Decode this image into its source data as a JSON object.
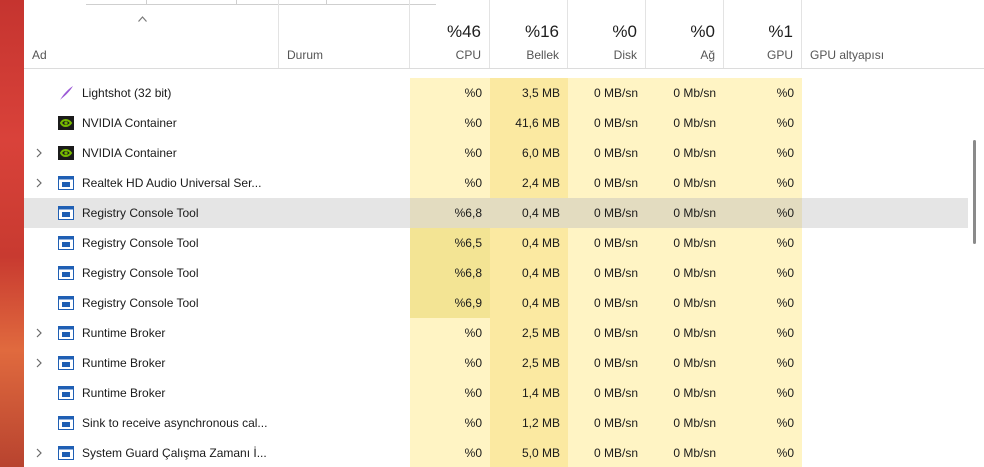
{
  "header": {
    "name_label": "Ad",
    "status_label": "Durum",
    "cpu": {
      "percent": "%46",
      "label": "CPU"
    },
    "memory": {
      "percent": "%16",
      "label": "Bellek"
    },
    "disk": {
      "percent": "%0",
      "label": "Disk"
    },
    "network": {
      "percent": "%0",
      "label": "Ağ"
    },
    "gpu": {
      "percent": "%1",
      "label": "GPU"
    },
    "gpu_engine_label": "GPU altyapısı"
  },
  "rows": [
    {
      "name": "Lightshot (32 bit)",
      "icon": "lightshot-feather-icon",
      "expandable": false,
      "selected": false,
      "cpu": "%0",
      "memory": "3,5 MB",
      "disk": "0 MB/sn",
      "network": "0 Mb/sn",
      "gpu": "%0"
    },
    {
      "name": "NVIDIA Container",
      "icon": "nvidia-icon",
      "expandable": false,
      "selected": false,
      "cpu": "%0",
      "memory": "41,6 MB",
      "disk": "0 MB/sn",
      "network": "0 Mb/sn",
      "gpu": "%0"
    },
    {
      "name": "NVIDIA Container",
      "icon": "nvidia-icon",
      "expandable": true,
      "selected": false,
      "cpu": "%0",
      "memory": "6,0 MB",
      "disk": "0 MB/sn",
      "network": "0 Mb/sn",
      "gpu": "%0"
    },
    {
      "name": "Realtek HD Audio Universal Ser...",
      "icon": "service-window-icon",
      "expandable": true,
      "selected": false,
      "cpu": "%0",
      "memory": "2,4 MB",
      "disk": "0 MB/sn",
      "network": "0 Mb/sn",
      "gpu": "%0"
    },
    {
      "name": "Registry Console Tool",
      "icon": "service-window-icon",
      "expandable": false,
      "selected": true,
      "cpu": "%6,8",
      "memory": "0,4 MB",
      "disk": "0 MB/sn",
      "network": "0 Mb/sn",
      "gpu": "%0"
    },
    {
      "name": "Registry Console Tool",
      "icon": "service-window-icon",
      "expandable": false,
      "selected": false,
      "cpu": "%6,5",
      "memory": "0,4 MB",
      "disk": "0 MB/sn",
      "network": "0 Mb/sn",
      "gpu": "%0"
    },
    {
      "name": "Registry Console Tool",
      "icon": "service-window-icon",
      "expandable": false,
      "selected": false,
      "cpu": "%6,8",
      "memory": "0,4 MB",
      "disk": "0 MB/sn",
      "network": "0 Mb/sn",
      "gpu": "%0"
    },
    {
      "name": "Registry Console Tool",
      "icon": "service-window-icon",
      "expandable": false,
      "selected": false,
      "cpu": "%6,9",
      "memory": "0,4 MB",
      "disk": "0 MB/sn",
      "network": "0 Mb/sn",
      "gpu": "%0"
    },
    {
      "name": "Runtime Broker",
      "icon": "service-window-icon",
      "expandable": true,
      "selected": false,
      "cpu": "%0",
      "memory": "2,5 MB",
      "disk": "0 MB/sn",
      "network": "0 Mb/sn",
      "gpu": "%0"
    },
    {
      "name": "Runtime Broker",
      "icon": "service-window-icon",
      "expandable": true,
      "selected": false,
      "cpu": "%0",
      "memory": "2,5 MB",
      "disk": "0 MB/sn",
      "network": "0 Mb/sn",
      "gpu": "%0"
    },
    {
      "name": "Runtime Broker",
      "icon": "service-window-icon",
      "expandable": false,
      "selected": false,
      "cpu": "%0",
      "memory": "1,4 MB",
      "disk": "0 MB/sn",
      "network": "0 Mb/sn",
      "gpu": "%0"
    },
    {
      "name": "Sink to receive asynchronous cal...",
      "icon": "service-window-icon",
      "expandable": false,
      "selected": false,
      "cpu": "%0",
      "memory": "1,2 MB",
      "disk": "0 MB/sn",
      "network": "0 Mb/sn",
      "gpu": "%0"
    },
    {
      "name": "System Guard Çalışma Zamanı İ...",
      "icon": "service-window-icon",
      "expandable": true,
      "selected": false,
      "cpu": "%0",
      "memory": "5,0 MB",
      "disk": "0 MB/sn",
      "network": "0 Mb/sn",
      "gpu": "%0"
    }
  ],
  "colors": {
    "heat_low": "#fff4c4",
    "heat_mid": "#f9eca8",
    "heat_high": "#f3e494",
    "selection": "#e5e5e5",
    "nvidia_green": "#76b900",
    "service_blue": "#1f5fb4",
    "lightshot_purple": "#9b59d6"
  }
}
